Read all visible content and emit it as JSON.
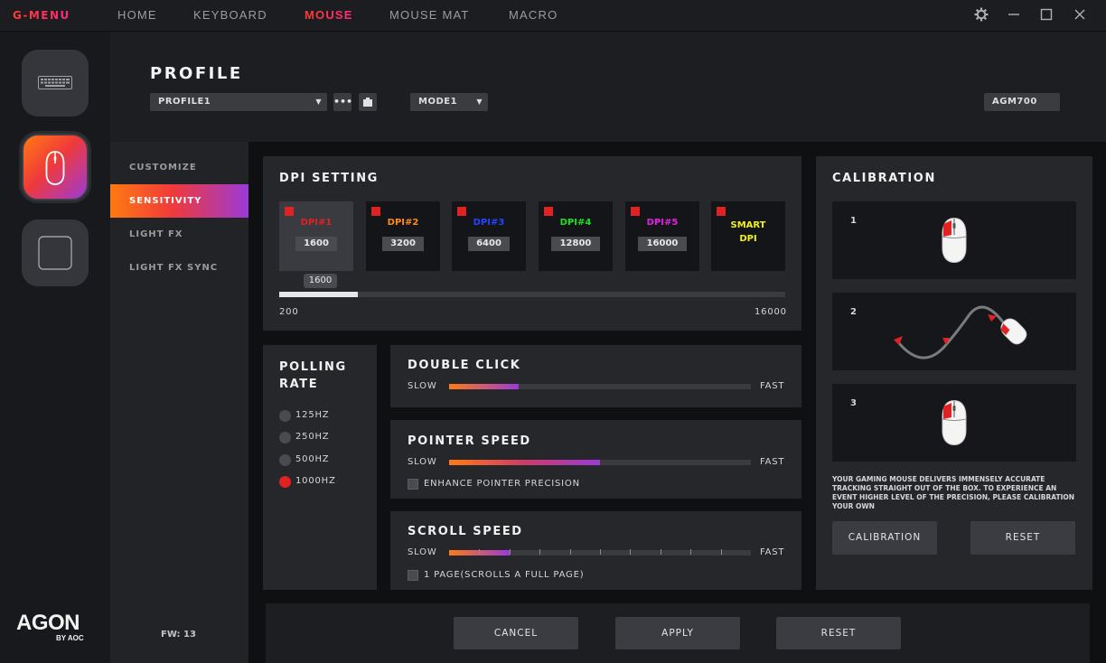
{
  "app": {
    "brand": "G-MENU"
  },
  "nav": {
    "home": "HOME",
    "keyboard": "KEYBOARD",
    "mouse": "MOUSE",
    "mouse_mat": "MOUSE MAT",
    "macro": "MACRO"
  },
  "window": {
    "settings_icon": "gear-icon",
    "minimize_icon": "minimize-icon",
    "maximize_icon": "maximize-icon",
    "close_icon": "close-icon"
  },
  "rail": {
    "logo": "AGON",
    "logo_sub": "BY AOC"
  },
  "header": {
    "title": "PROFILE",
    "profile_select": "PROFILE1",
    "mode_select": "MODE1",
    "device": "AGM700",
    "more_icon": "more-icon",
    "save_icon": "save-icon"
  },
  "submenu": {
    "items": [
      "CUSTOMIZE",
      "SENSITIVITY",
      "LIGHT FX",
      "LIGHT FX SYNC"
    ],
    "active": "SENSITIVITY",
    "fw": "FW: 13"
  },
  "dpi": {
    "title": "DPI SETTING",
    "stages": [
      {
        "label": "DPI#1",
        "value": "1600",
        "color": "#e02222"
      },
      {
        "label": "DPI#2",
        "value": "3200",
        "color": "#ff8a1a"
      },
      {
        "label": "DPI#3",
        "value": "6400",
        "color": "#2244ff"
      },
      {
        "label": "DPI#4",
        "value": "12800",
        "color": "#22e022"
      },
      {
        "label": "DPI#5",
        "value": "16000",
        "color": "#e022e0"
      }
    ],
    "smart": {
      "line1": "SMART",
      "line2": "DPI",
      "color": "#f2f21a"
    },
    "slider": {
      "current": "1600",
      "min": "200",
      "max": "16000",
      "value": 1600,
      "min_value": 200,
      "max_value": 16000
    }
  },
  "polling": {
    "title_line1": "POLLING",
    "title_line2": "RATE",
    "options": [
      "125HZ",
      "250HZ",
      "500HZ",
      "1000HZ"
    ],
    "selected": "1000HZ"
  },
  "double_click": {
    "title": "DOUBLE CLICK",
    "slow": "SLOW",
    "fast": "FAST",
    "level": 0.23
  },
  "pointer_speed": {
    "title": "POINTER SPEED",
    "slow": "SLOW",
    "fast": "FAST",
    "level": 0.5,
    "enhance_label": "ENHANCE POINTER PRECISION"
  },
  "scroll_speed": {
    "title": "SCROLL SPEED",
    "slow": "SLOW",
    "fast": "FAST",
    "level": 0.2,
    "page_label": "1 PAGE(SCROLLS A FULL PAGE)"
  },
  "calibration": {
    "title": "CALIBRATION",
    "steps": [
      "1",
      "2",
      "3"
    ],
    "description": "YOUR GAMING MOUSE DELIVERS IMMENSELY ACCURATE TRACKING STRAIGHT OUT OF THE BOX. TO EXPERIENCE AN EVENT HIGHER LEVEL OF THE PRECISION, PLEASE CALIBRATION YOUR OWN",
    "calibrate_button": "CALIBRATION",
    "reset_button": "RESET"
  },
  "footer": {
    "cancel": "CANCEL",
    "apply": "APPLY",
    "reset": "RESET"
  },
  "colors": {
    "accent_orange": "#ff7a12",
    "accent_red": "#f03a3a",
    "accent_purple": "#9a3ad8"
  }
}
